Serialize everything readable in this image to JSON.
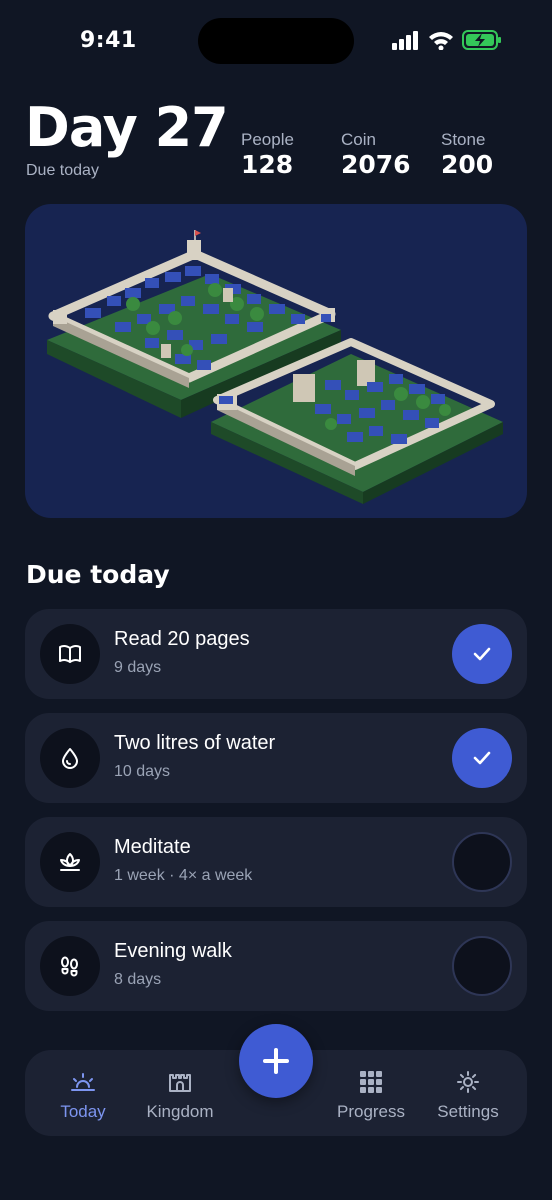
{
  "status_bar": {
    "time": "9:41"
  },
  "header": {
    "day_title": "Day 27",
    "subtitle": "Due today",
    "stats": [
      {
        "label": "People",
        "value": "128"
      },
      {
        "label": "Coin",
        "value": "2076"
      },
      {
        "label": "Stone",
        "value": "200"
      }
    ]
  },
  "section": {
    "title": "Due today"
  },
  "habits": [
    {
      "name": "Read 20 pages",
      "meta": "9 days",
      "icon": "book-icon",
      "done": true
    },
    {
      "name": "Two litres of water",
      "meta": "10 days",
      "icon": "water-drop-icon",
      "done": true
    },
    {
      "name": "Meditate",
      "meta": "1 week · 4× a week",
      "icon": "lotus-icon",
      "done": false
    },
    {
      "name": "Evening walk",
      "meta": "8 days",
      "icon": "footsteps-icon",
      "done": false
    }
  ],
  "nav": {
    "items": [
      {
        "label": "Today",
        "icon": "sunrise-icon",
        "active": true
      },
      {
        "label": "Kingdom",
        "icon": "castle-icon",
        "active": false
      },
      {
        "label": "Progress",
        "icon": "grid-icon",
        "active": false
      },
      {
        "label": "Settings",
        "icon": "gear-icon",
        "active": false
      }
    ],
    "fab_icon": "plus-icon"
  },
  "colors": {
    "background": "#101624",
    "card": "#1c2233",
    "accent": "#3f5bd3",
    "kingdom_bg": "#172451"
  }
}
